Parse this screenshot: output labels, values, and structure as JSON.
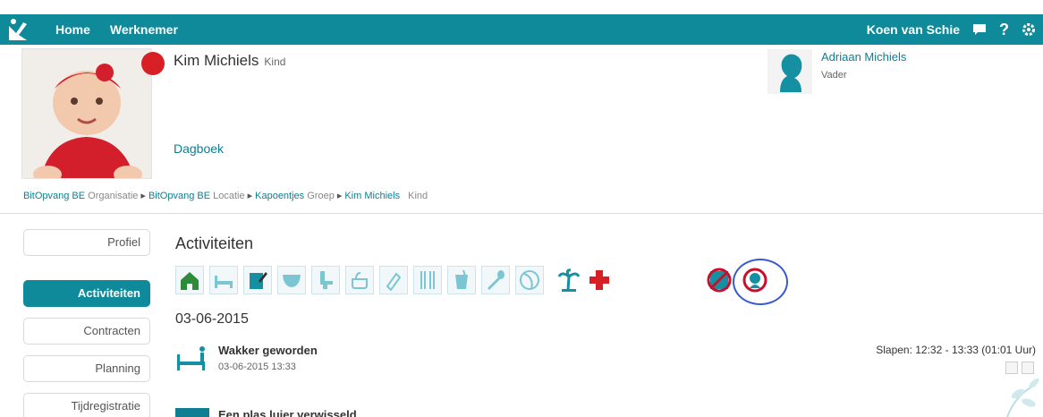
{
  "nav": {
    "home": "Home",
    "werknemer": "Werknemer",
    "user": "Koen van Schie",
    "help": "?"
  },
  "profile": {
    "name": "Kim Michiels",
    "role": "Kind",
    "diary_link": "Dagboek"
  },
  "parent": {
    "name": "Adriaan Michiels",
    "role": "Vader"
  },
  "breadcrumb": [
    {
      "text": "BitOpvang BE",
      "kind": "Organisatie"
    },
    {
      "text": "BitOpvang BE",
      "kind": "Locatie"
    },
    {
      "text": "Kapoentjes",
      "kind": "Groep"
    },
    {
      "text": "Kim Michiels",
      "kind": "Kind"
    }
  ],
  "sidebar": {
    "items": [
      {
        "label": "Profiel",
        "active": false
      },
      {
        "label": "Activiteiten",
        "active": true
      },
      {
        "label": "Contracten",
        "active": false
      },
      {
        "label": "Planning",
        "active": false
      },
      {
        "label": "Tijdregistratie",
        "active": false
      }
    ]
  },
  "main": {
    "title": "Activiteiten",
    "date": "03-06-2015",
    "activity_icons": [
      "home-icon",
      "bed-icon",
      "notepad-icon",
      "diaper-icon",
      "potty-icon",
      "bath-icon",
      "basket-icon",
      "bottle-icon",
      "cutlery-icon",
      "drink-icon",
      "spoon-icon",
      "ball-icon",
      "palm-tree-icon",
      "red-cross-icon",
      "not-allowed-icon",
      "person-icon"
    ],
    "entries": [
      {
        "title": "Wakker geworden",
        "time": "03-06-2015 13:33",
        "summary": "Slapen: 12:32 - 13:33 (01:01 Uur)"
      },
      {
        "title": "Een plas luier verwisseld",
        "time": "",
        "summary": ""
      }
    ]
  },
  "colors": {
    "brand": "#0e8a9a",
    "accent": "#0e7f92",
    "alert": "#d62025"
  }
}
